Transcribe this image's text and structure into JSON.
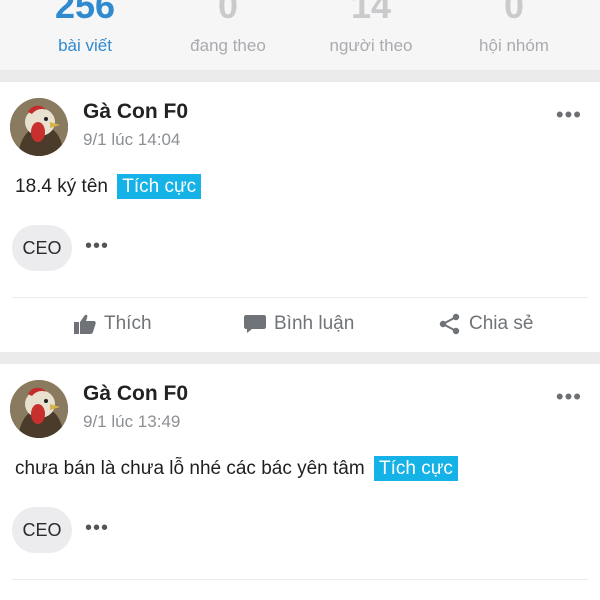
{
  "stats": [
    {
      "value": "256",
      "label": "bài viết",
      "active": true
    },
    {
      "value": "0",
      "label": "đang theo",
      "active": false
    },
    {
      "value": "14",
      "label": "người theo",
      "active": false
    },
    {
      "value": "0",
      "label": "hội nhóm",
      "active": false
    }
  ],
  "posts": [
    {
      "author": "Gà Con F0",
      "time": "9/1 lúc 14:04",
      "text": "18.4 ký tên",
      "tag": "Tích cực",
      "badge": "CEO",
      "more": "•••",
      "mini_more": "•••",
      "actions": {
        "like": "Thích",
        "comment": "Bình luận",
        "share": "Chia sẻ"
      }
    },
    {
      "author": "Gà Con F0",
      "time": "9/1 lúc 13:49",
      "text": "chưa bán là chưa lỗ nhé các bác yên tâm",
      "tag": "Tích cực",
      "badge": "CEO",
      "more": "•••",
      "mini_more": "•••"
    }
  ],
  "colors": {
    "accent": "#2f8ad0",
    "tag_bg": "#14b2e6",
    "muted": "#8c8f93"
  }
}
